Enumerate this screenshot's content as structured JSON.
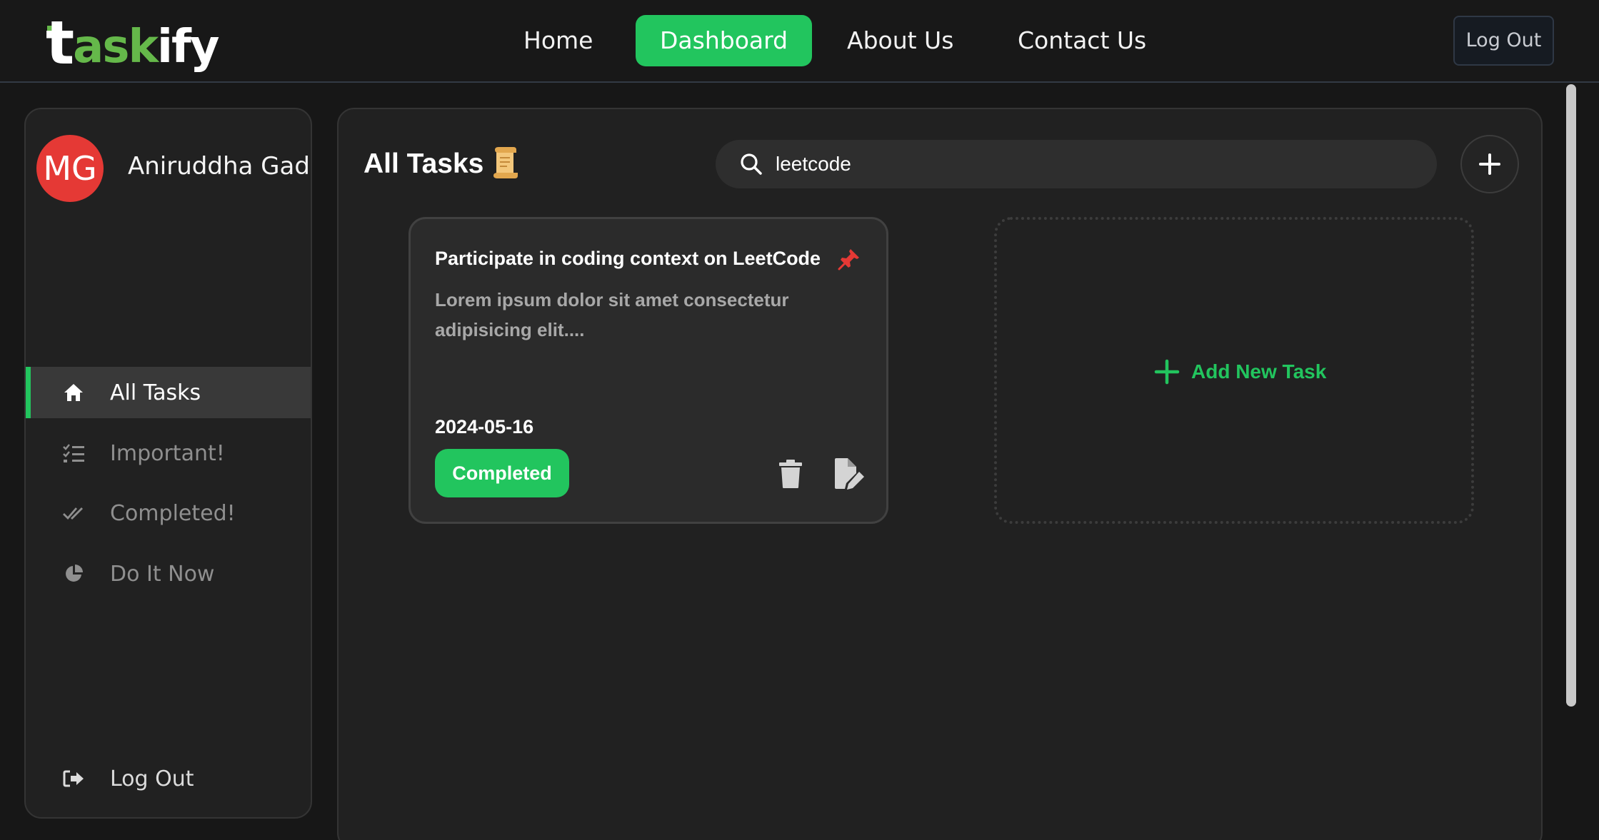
{
  "app": {
    "logo": {
      "t": "t",
      "ask": "ask",
      "ify": "ify",
      "full": "taskify"
    }
  },
  "nav": {
    "links": [
      {
        "label": "Home",
        "active": false
      },
      {
        "label": "Dashboard",
        "active": true
      },
      {
        "label": "About Us",
        "active": false
      },
      {
        "label": "Contact Us",
        "active": false
      }
    ],
    "logout_label": "Log Out"
  },
  "sidebar": {
    "user": {
      "initials": "MG",
      "name": "Aniruddha Gade",
      "avatar_color": "#e53935"
    },
    "items": [
      {
        "label": "All Tasks",
        "icon": "home-icon",
        "active": true
      },
      {
        "label": "Important!",
        "icon": "list-check-icon",
        "active": false
      },
      {
        "label": "Completed!",
        "icon": "double-check-icon",
        "active": false
      },
      {
        "label": "Do It Now",
        "icon": "pie-chart-icon",
        "active": false
      }
    ],
    "logout": {
      "label": "Log Out",
      "icon": "sign-out-icon"
    }
  },
  "main": {
    "title": "All Tasks",
    "title_icon": "scroll-icon",
    "search": {
      "value": "leetcode",
      "placeholder": ""
    },
    "tasks": [
      {
        "title": "Participate in coding context on LeetCode",
        "description": "Lorem ipsum dolor sit amet consectetur adipisicing elit....",
        "date": "2024-05-16",
        "status": "Completed",
        "pinned": true
      }
    ],
    "add_task_label": "Add New Task"
  },
  "colors": {
    "accent": "#22c55e",
    "logo_green": "#65b84a",
    "background": "#171717",
    "panel": "#212121",
    "card": "#2b2b2b",
    "pin": "#e53935"
  }
}
